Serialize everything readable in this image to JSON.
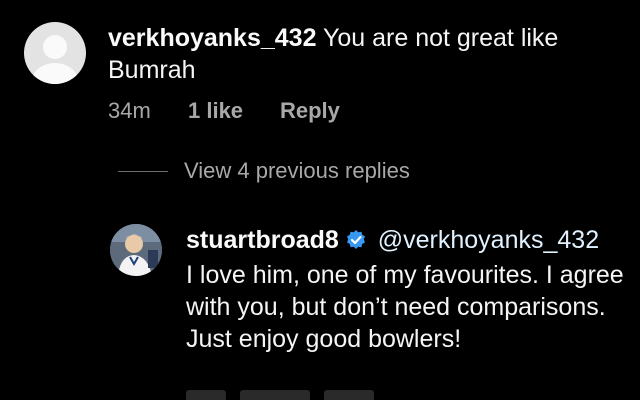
{
  "comment": {
    "username": "verkhoyanks_432",
    "text": "You are not great like Bumrah",
    "time": "34m",
    "likes": "1 like",
    "reply_label": "Reply"
  },
  "view_replies": {
    "label": "View 4 previous replies"
  },
  "reply": {
    "username": "stuartbroad8",
    "mention": "@verkhoyanks_432",
    "text": "I love him, one of my favourites. I agree with you, but don’t need comparisons. Just enjoy good bowlers!",
    "verified_icon": "verified-badge-icon",
    "verified_color": "#3897f0"
  }
}
